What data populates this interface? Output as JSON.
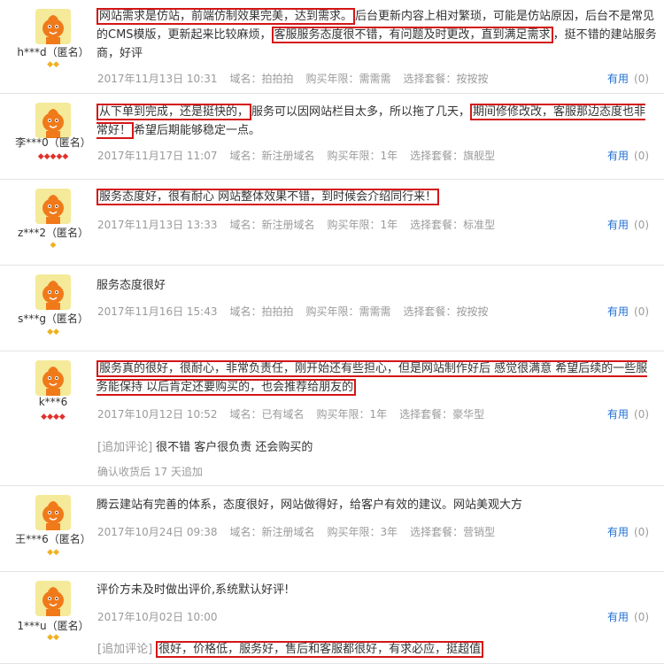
{
  "reviews": [
    {
      "user": "h***d（匿名）",
      "badge_type": "gold",
      "badge_count": 2,
      "content_parts": [
        {
          "text": "网站需求是仿站，前端仿制效果完美，达到需求。",
          "hl": true
        },
        {
          "text": "后台更新内容上相对繁琐，可能是仿站原因，后台不是常见的CMS模版，更新起来比较麻烦，",
          "hl": false
        },
        {
          "text": "客服服务态度很不错，有问题及时更改，直到满足需求",
          "hl": true
        },
        {
          "text": "，挺不错的建站服务商，好评",
          "hl": false
        }
      ],
      "date": "2017年11月13日 10:31",
      "domain": "域名：拍拍拍",
      "years": "购买年限：需需需",
      "package": "选择套餐：按按按",
      "useful_label": "有用",
      "useful_count": "(0)"
    },
    {
      "user": "李***0（匿名）",
      "badge_type": "red",
      "badge_count": 5,
      "content_parts": [
        {
          "text": "从下单到完成，还是挺快的，",
          "hl": true
        },
        {
          "text": "服务可以因网站栏目太多，所以拖了几天，",
          "hl": false
        },
        {
          "text": "期间修修改改，客服那边态度也非常好！",
          "hl": true
        },
        {
          "text": "希望后期能够稳定一点。",
          "hl": false
        }
      ],
      "date": "2017年11月17日 11:07",
      "domain": "域名：新注册域名",
      "years": "购买年限：1年",
      "package": "选择套餐：旗舰型",
      "useful_label": "有用",
      "useful_count": "(0)"
    },
    {
      "user": "z***2（匿名）",
      "badge_type": "gold",
      "badge_count": 1,
      "content_parts": [
        {
          "text": "服务态度好，很有耐心 网站整体效果不错，到时候会介绍同行来！",
          "hl": true
        }
      ],
      "date": "2017年11月13日 13:33",
      "domain": "域名：新注册域名",
      "years": "购买年限：1年",
      "package": "选择套餐：标准型",
      "useful_label": "有用",
      "useful_count": "(0)"
    },
    {
      "user": "s***g（匿名）",
      "badge_type": "gold",
      "badge_count": 2,
      "content_parts": [
        {
          "text": "服务态度很好",
          "hl": false
        }
      ],
      "date": "2017年11月16日 15:43",
      "domain": "域名：拍拍拍",
      "years": "购买年限：需需需",
      "package": "选择套餐：按按按",
      "useful_label": "有用",
      "useful_count": "(0)"
    },
    {
      "user": "k***6",
      "badge_type": "red",
      "badge_count": 4,
      "content_parts": [
        {
          "text": "服务真的很好，很耐心，非常负责任，刚开始还有些担心，但是网站制作好后 感觉很满意 希望后续的一些服务能保持 以后肯定还要购买的，也会推荐给朋友的",
          "hl": true
        }
      ],
      "date": "2017年10月12日 10:52",
      "domain": "域名：已有域名",
      "years": "购买年限：1年",
      "package": "选择套餐：豪华型",
      "useful_label": "有用",
      "useful_count": "(0)",
      "append_tag": "[追加评论]",
      "append_text": "很不错 客户很负责 还会购买的",
      "append_note": "确认收货后 17 天追加"
    },
    {
      "user": "王***6（匿名）",
      "badge_type": "gold",
      "badge_count": 2,
      "content_parts": [
        {
          "text": "腾云建站有完善的体系，态度很好，网站做得好，给客户有效的建议。网站美观大方",
          "hl": false
        }
      ],
      "date": "2017年10月24日 09:38",
      "domain": "域名：新注册域名",
      "years": "购买年限：3年",
      "package": "选择套餐：营销型",
      "useful_label": "有用",
      "useful_count": "(0)"
    },
    {
      "user": "1***u（匿名）",
      "badge_type": "gold",
      "badge_count": 2,
      "content_parts": [
        {
          "text": "评价方未及时做出评价,系统默认好评!",
          "hl": false
        }
      ],
      "date": "2017年10月02日 10:00",
      "domain": "",
      "years": "",
      "package": "",
      "useful_label": "有用",
      "useful_count": "(0)",
      "append_tag": "[追加评论]",
      "append_text": "很好，价格低，服务好，售后和客服都很好，有求必应，挺超值",
      "append_hl": true
    }
  ]
}
